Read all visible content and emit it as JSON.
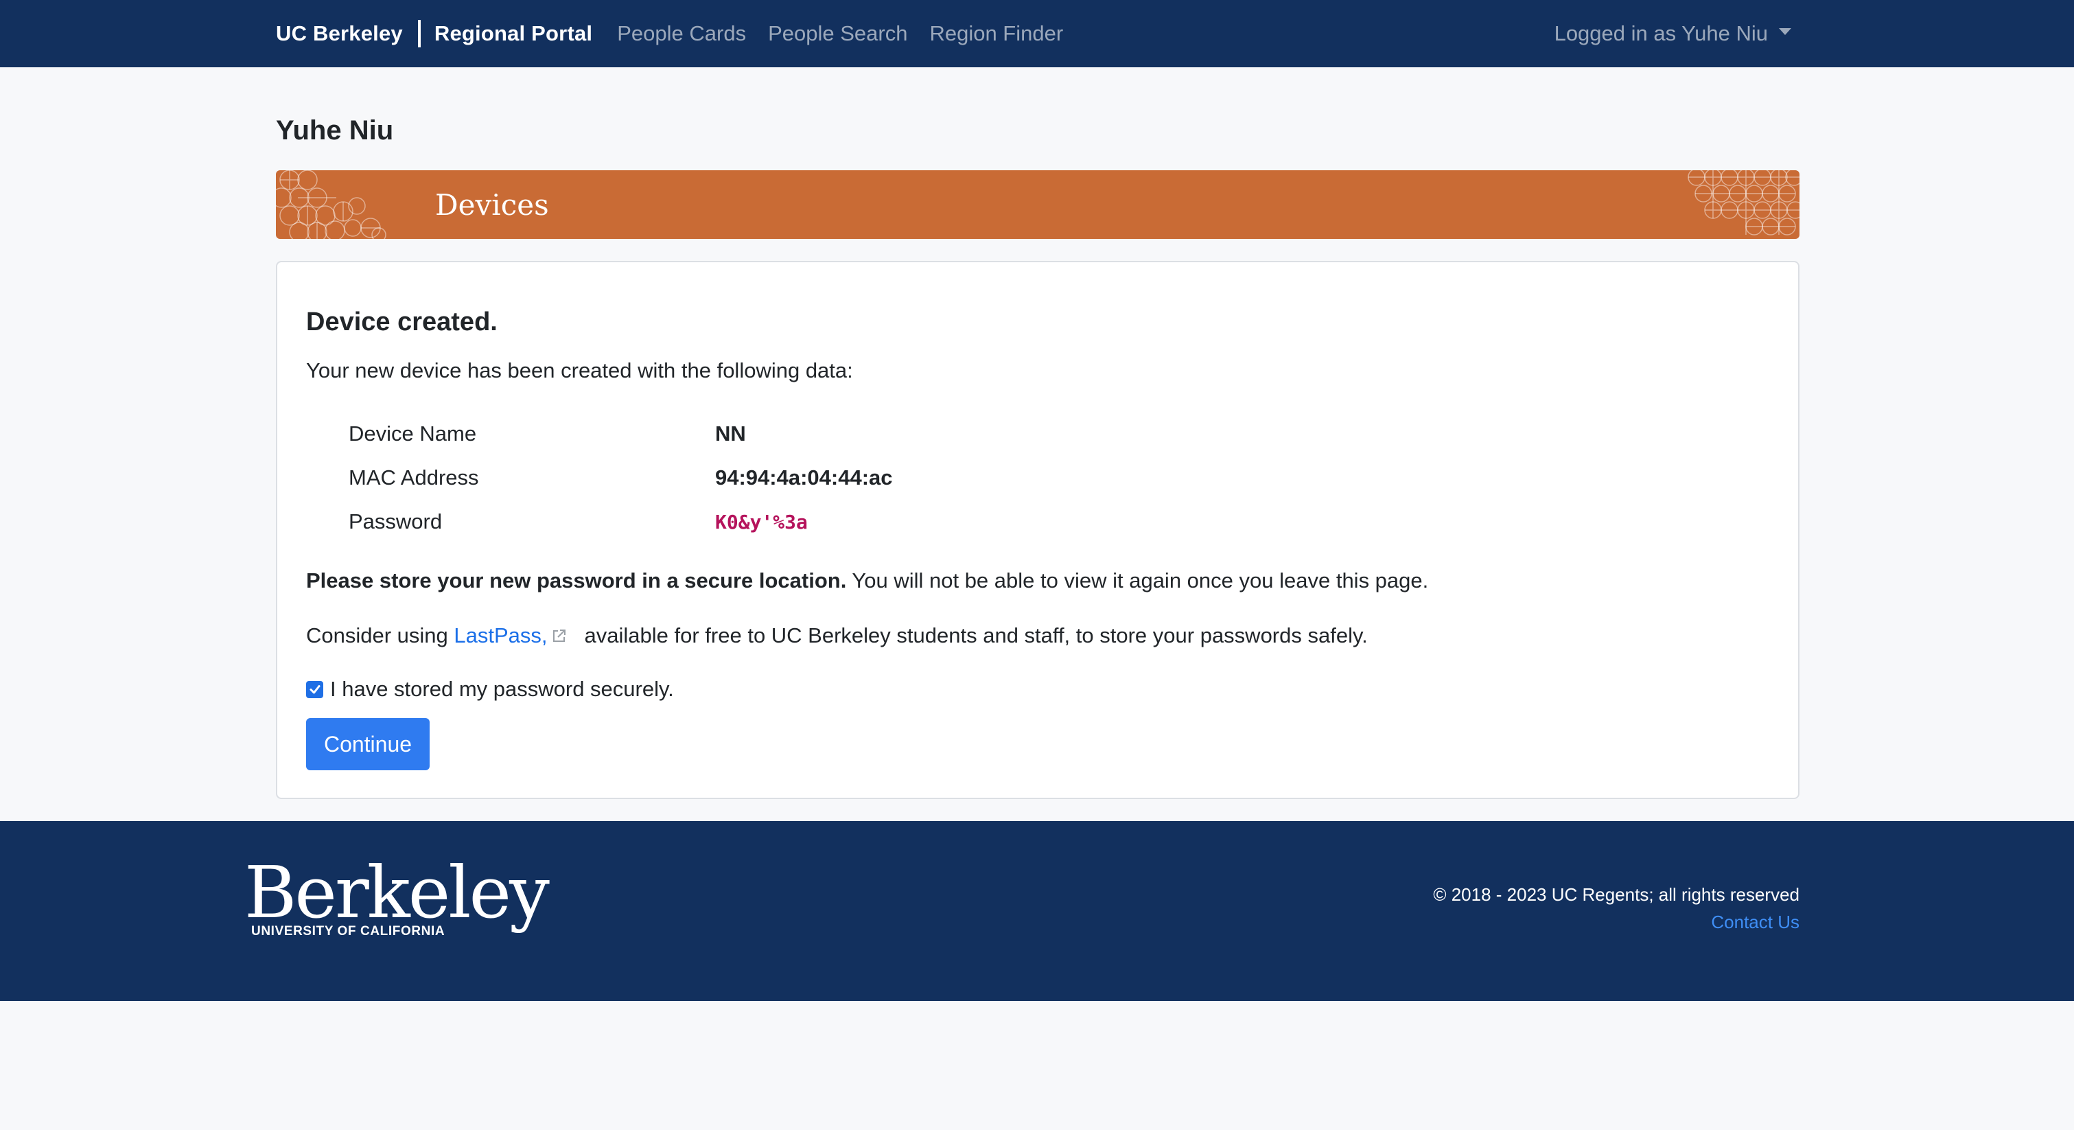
{
  "navbar": {
    "brand": "UC Berkeley",
    "portal": "Regional Portal",
    "links": [
      "People Cards",
      "People Search",
      "Region Finder"
    ],
    "user": "Logged in as Yuhe Niu"
  },
  "page": {
    "user_name": "Yuhe Niu",
    "banner_title": "Devices"
  },
  "card": {
    "heading": "Device created.",
    "intro": "Your new device has been created with the following data:",
    "fields": [
      {
        "label": "Device Name",
        "value": "NN"
      },
      {
        "label": "MAC Address",
        "value": "94:94:4a:04:44:ac"
      },
      {
        "label": "Password",
        "value": "K0&y'%3a"
      }
    ],
    "warning_bold": "Please store your new password in a secure location.",
    "warning_rest": " You will not be able to view it again once you leave this page.",
    "lastpass_prefix": "Consider using ",
    "lastpass_link": "LastPass,",
    "lastpass_suffix": "available for free to UC Berkeley students and staff, to store your passwords safely.",
    "checkbox_label": "I have stored my password securely.",
    "checkbox_checked": true,
    "continue_label": "Continue"
  },
  "footer": {
    "logo_word": "Berkeley",
    "logo_sub": "UNIVERSITY OF CALIFORNIA",
    "copyright": "© 2018 - 2023 UC Regents; all rights reserved",
    "contact": "Contact Us"
  },
  "colors": {
    "navy": "#12305e",
    "banner_orange": "#c96b35",
    "link_blue": "#1b6fe8",
    "button_blue": "#2f7bf0",
    "password_magenta": "#b5135c"
  },
  "icons": [
    "chevron-down-icon",
    "external-link-icon",
    "checkmark-icon",
    "pattern-decoration"
  ]
}
